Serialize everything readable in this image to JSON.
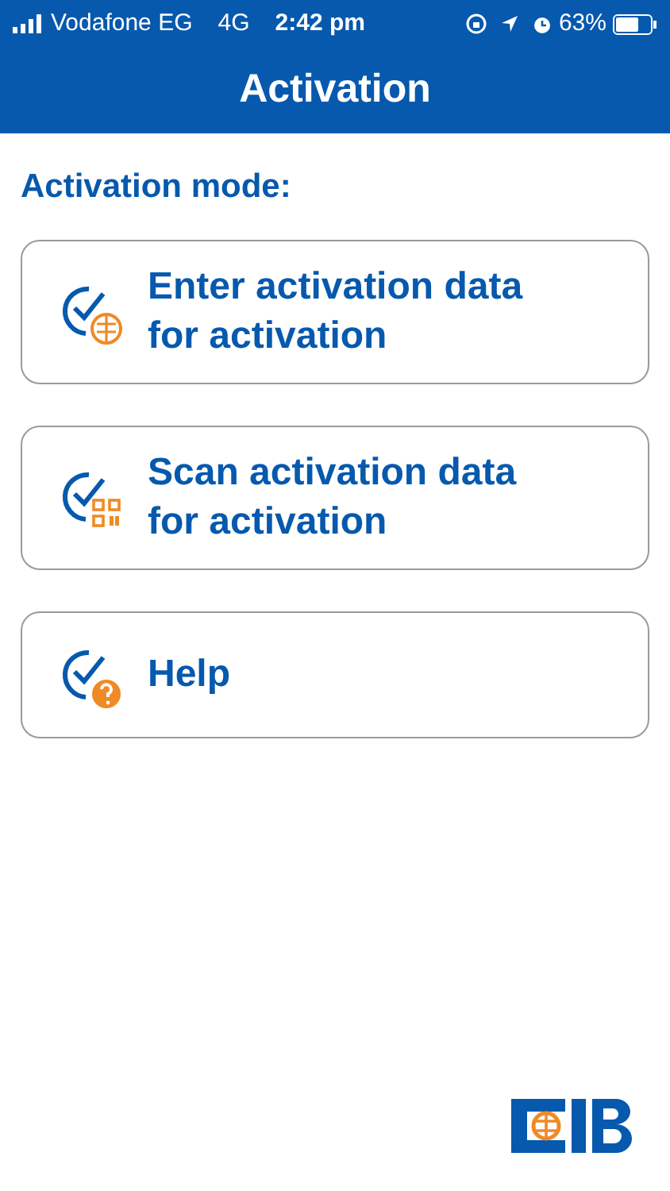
{
  "status_bar": {
    "carrier": "Vodafone EG",
    "network": "4G",
    "time": "2:42 pm",
    "battery": "63%"
  },
  "nav_bar": {
    "title": "Activation"
  },
  "section_title": "Activation mode:",
  "options": [
    {
      "kind": "enter",
      "lines": [
        "Enter activation data",
        "for activation"
      ]
    },
    {
      "kind": "scan",
      "lines": [
        "Scan activation data",
        "for activation"
      ]
    },
    {
      "kind": "help",
      "lines": [
        "Help"
      ]
    }
  ]
}
